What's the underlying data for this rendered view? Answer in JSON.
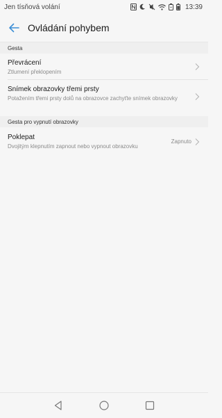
{
  "status_bar": {
    "carrier": "Jen tísňová volání",
    "time": "13:39",
    "icons": [
      "nfc-icon",
      "dnd-icon",
      "mute-icon",
      "wifi-icon",
      "battery-saver-icon",
      "battery-icon"
    ]
  },
  "app_bar": {
    "title": "Ovládání pohybem"
  },
  "sections": [
    {
      "header": "Gesta",
      "items": [
        {
          "title": "Převrácení",
          "subtitle": "Ztlumení překlopením"
        },
        {
          "title": "Snímek obrazovky třemi prsty",
          "subtitle": "Potažením třemi prsty dolů na obrazovce zachyťte snímek obrazovky"
        }
      ]
    },
    {
      "header": "Gesta pro vypnutí obrazovky",
      "items": [
        {
          "title": "Poklepat",
          "subtitle": "Dvojitým klepnutím zapnout nebo vypnout obrazovku",
          "value": "Zapnuto"
        }
      ]
    }
  ],
  "colors": {
    "accent": "#3d8fd6",
    "background": "#f6f6f6"
  }
}
